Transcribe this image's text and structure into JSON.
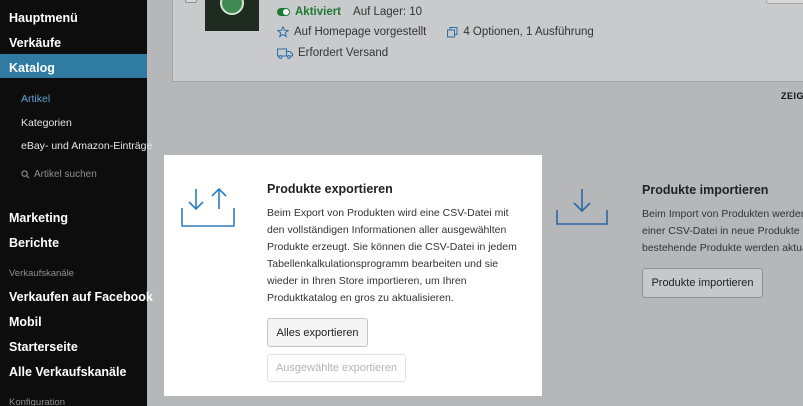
{
  "sidebar": {
    "main_menu": "Hauptmenü",
    "sales": "Verkäufe",
    "catalog": "Katalog",
    "catalog_sub": {
      "items": "Artikel",
      "categories": "Kategorien",
      "ebay_amazon": "eBay- und Amazon-Einträge",
      "search_placeholder": "Artikel suchen"
    },
    "marketing": "Marketing",
    "reports": "Berichte",
    "channels_heading": "Verkaufskanäle",
    "facebook": "Verkaufen auf Facebook",
    "mobile": "Mobil",
    "starter": "Starterseite",
    "all_channels": "Alle Verkaufskanäle",
    "config": "Konfiguration"
  },
  "product": {
    "status": "Aktiviert",
    "stock": "Auf Lager: 10",
    "featured": "Auf Homepage vorgestellt",
    "options": "4 Optionen, 1 Ausführung",
    "shipping": "Erfordert Versand"
  },
  "zeige_label": "ZEIGE",
  "export": {
    "title": "Produkte exportieren",
    "description": "Beim Export von Produkten wird eine CSV-Datei mit den vollständigen Informationen aller ausgewählten Produkte erzeugt. Sie können die CSV-Datei in jedem Tabellenkalkulationsprogramm bearbeiten und sie wieder in Ihren Store importieren, um Ihren Produktkatalog en gros zu aktualisieren.",
    "export_all_button": "Alles exportieren",
    "export_selected_button": "Ausgewählte exportieren"
  },
  "import": {
    "title": "Produkte importieren",
    "desc_line1": "Beim Import von Produkten werden",
    "desc_line2": "einer CSV-Datei in neue Produkte k",
    "desc_line3": "bestehende Produkte werden aktua",
    "import_button": "Produkte importieren"
  },
  "colors": {
    "sidebar_bg": "#0d0d0d",
    "sidebar_active": "#2f7ba2",
    "accent_blue": "#2b7fc0",
    "status_green": "#1d7a36"
  }
}
